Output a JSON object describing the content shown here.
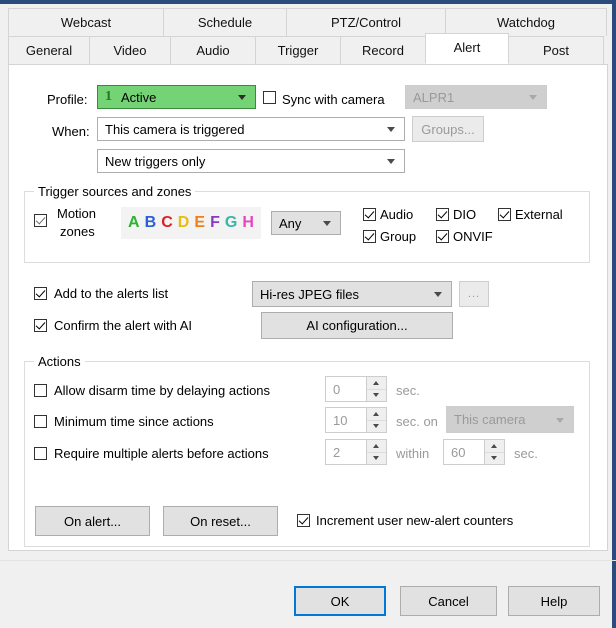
{
  "window": {
    "accent_color": "#2b4b7d"
  },
  "tabs": {
    "row1": [
      {
        "label": "Webcast",
        "selected": false
      },
      {
        "label": "Schedule",
        "selected": false
      },
      {
        "label": "PTZ/Control",
        "selected": false
      },
      {
        "label": "Watchdog",
        "selected": false
      }
    ],
    "row2": [
      {
        "label": "General",
        "selected": false
      },
      {
        "label": "Video",
        "selected": false
      },
      {
        "label": "Audio",
        "selected": false
      },
      {
        "label": "Trigger",
        "selected": false
      },
      {
        "label": "Record",
        "selected": false
      },
      {
        "label": "Alert",
        "selected": true
      },
      {
        "label": "Post",
        "selected": false
      }
    ]
  },
  "profile": {
    "label": "Profile:",
    "number": "1",
    "value": "Active",
    "color": "#74d374",
    "sync_checkbox_label": "Sync with camera",
    "sync_checked": false,
    "camera_value": "ALPR1",
    "camera_disabled": true
  },
  "when": {
    "label": "When:",
    "value": "This camera is triggered",
    "second_value": "New triggers only",
    "groups_button": "Groups...",
    "groups_disabled": true
  },
  "trigger_sources": {
    "title": "Trigger sources and zones",
    "motion_zones_checked": true,
    "motion_zones_label_line1": "Motion",
    "motion_zones_label_line2": "zones",
    "zone_letters": [
      {
        "letter": "A",
        "color": "#2db32d"
      },
      {
        "letter": "B",
        "color": "#2b5fd9"
      },
      {
        "letter": "C",
        "color": "#e02020"
      },
      {
        "letter": "D",
        "color": "#e8bc10"
      },
      {
        "letter": "E",
        "color": "#ef8019"
      },
      {
        "letter": "F",
        "color": "#8b38c4"
      },
      {
        "letter": "G",
        "color": "#39b5a8"
      },
      {
        "letter": "H",
        "color": "#e545c2"
      }
    ],
    "zone_mode": "Any",
    "checkboxes": [
      {
        "label": "Audio",
        "checked": true
      },
      {
        "label": "DIO",
        "checked": true
      },
      {
        "label": "External",
        "checked": true
      },
      {
        "label": "Group",
        "checked": true
      },
      {
        "label": "ONVIF",
        "checked": true
      }
    ]
  },
  "alerts": {
    "add_to_list_label": "Add to the alerts list",
    "add_to_list_checked": true,
    "file_format": "Hi-res JPEG files",
    "browse_button": "...",
    "confirm_ai_label": "Confirm the alert with AI",
    "confirm_ai_checked": true,
    "ai_config_button": "AI configuration..."
  },
  "actions": {
    "title": "Actions",
    "rows": [
      {
        "label": "Allow disarm time by delaying actions",
        "checked": false,
        "value": "0",
        "unit": "sec."
      },
      {
        "label": "Minimum time since actions",
        "checked": false,
        "value": "10",
        "unit": "sec. on",
        "target": "This camera"
      },
      {
        "label": "Require multiple alerts before actions",
        "checked": false,
        "value": "2",
        "unit": "within",
        "value2": "60",
        "unit2": "sec."
      }
    ],
    "on_alert_button": "On alert...",
    "on_reset_button": "On reset...",
    "increment_label": "Increment user new-alert counters",
    "increment_checked": true
  },
  "footer": {
    "ok": "OK",
    "cancel": "Cancel",
    "help": "Help"
  }
}
